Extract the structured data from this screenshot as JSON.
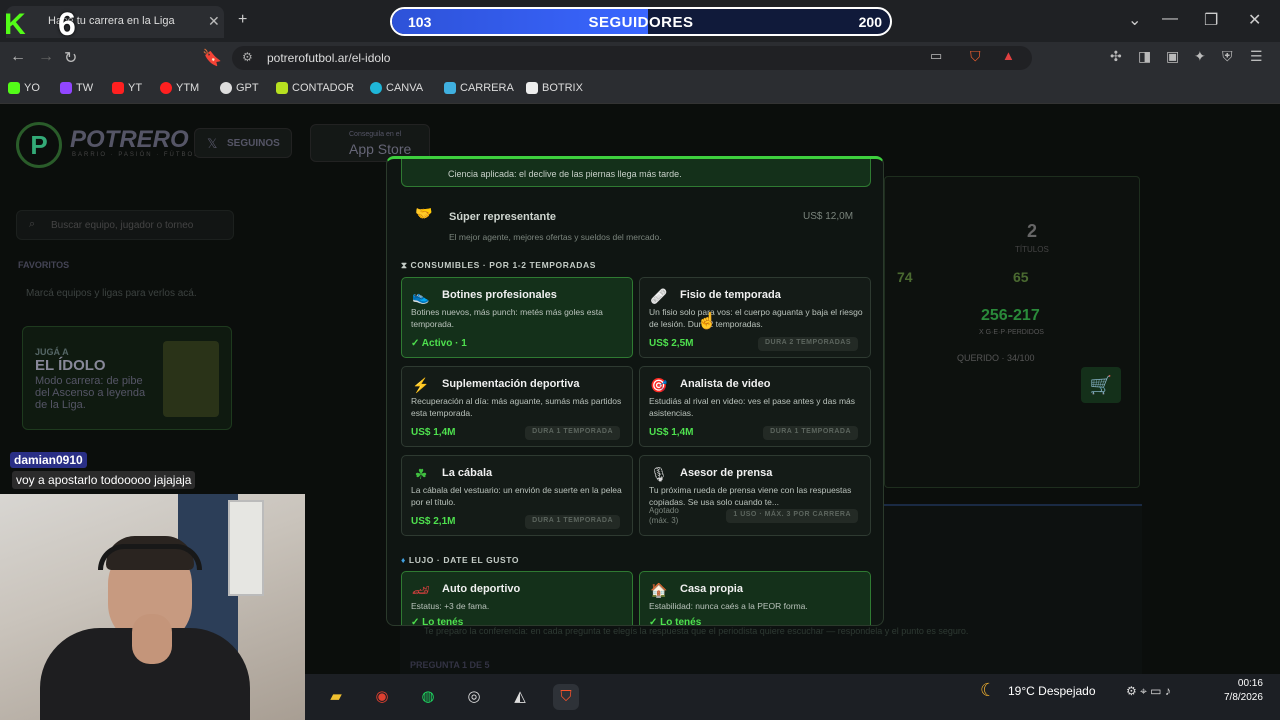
{
  "browser": {
    "tab_title": "Hacé tu carrera en la Liga",
    "url": "potrerofutbol.ar/el-idolo",
    "bookmarks": [
      "YO",
      "TW",
      "YT",
      "YTM",
      "GPT",
      "CONTADOR",
      "CANVA",
      "CARRERA",
      "BOTRIX"
    ]
  },
  "stream": {
    "kick_logo": "K",
    "overlay_number": "6",
    "followers": {
      "current": "103",
      "label": "SEGUIDORES",
      "goal": "200",
      "progress_fraction": 0.515
    },
    "chat": {
      "user": "damian0910",
      "message": "voy a apostarlo todooooo jajajaja"
    }
  },
  "site": {
    "brand": "POTRERO",
    "brand_sub": "BARRIO · PASIÓN · FÚTBOL",
    "follow_button": "SEGUINOS",
    "store_small": "Conseguila en el",
    "store_label": "App Store",
    "search_placeholder": "Buscar equipo, jugador o torneo",
    "favorites_header": "FAVORITOS",
    "favorites_text": "Marcá equipos y ligas para verlos acá.",
    "promo": {
      "kicker": "JUGÁ A",
      "title": "EL ÍDOLO",
      "text": "Modo carrera: de pibe del Ascenso a leyenda de la Liga."
    },
    "stats": {
      "titles_value": "2",
      "titles_label": "TÍTULOS",
      "stat_a": "74",
      "stat_b": "65",
      "record": "256-217",
      "record_label": "X G·E·P·PERDIDOS",
      "querido": "QUERIDO · 34/100"
    },
    "bottom_text": "Te preparo la conferencia: en cada pregunta te elegís la respuesta que el periodista quiere escuchar — respondela y el punto es seguro.",
    "bottom_question": "PREGUNTA 1 DE 5"
  },
  "modal": {
    "top_banner": "Ciencia aplicada: el declive de las piernas llega más tarde.",
    "representante": {
      "title": "Súper representante",
      "desc": "El mejor agente, mejores ofertas y sueldos del mercado.",
      "price": "US$ 12,0M"
    },
    "section_consumibles": "CONSUMIBLES · POR 1-2 TEMPORADAS",
    "cards": [
      {
        "title": "Botines profesionales",
        "desc": "Botines nuevos, más punch: metés más goles esta temporada.",
        "status": "✓ Activo · 1"
      },
      {
        "title": "Fisio de temporada",
        "desc": "Un fisio solo para vos: el cuerpo aguanta y baja el riesgo de lesión. Dura 2 temporadas.",
        "price": "US$ 2,5M",
        "button": "DURA 2 TEMPORADAS"
      },
      {
        "title": "Suplementación deportiva",
        "desc": "Recuperación al día: más aguante, sumás más partidos esta temporada.",
        "price": "US$ 1,4M",
        "button": "DURA 1 TEMPORADA"
      },
      {
        "title": "Analista de video",
        "desc": "Estudiás al rival en video: ves el pase antes y das más asistencias.",
        "price": "US$ 1,4M",
        "button": "DURA 1 TEMPORADA"
      },
      {
        "title": "La cábala",
        "desc": "La cábala del vestuario: un envión de suerte en la pelea por el título.",
        "price": "US$ 2,1M",
        "button": "DURA 1 TEMPORADA"
      },
      {
        "title": "Asesor de prensa",
        "desc": "Tu próxima rueda de prensa viene con las respuestas copiadas. Se usa solo cuando te...",
        "note": "Agotado (máx. 3)",
        "button": "1 USO · MÁX. 3 POR CARRERA"
      }
    ],
    "section_lujo": "LUJO · DATE EL GUSTO",
    "lujo": [
      {
        "title": "Auto deportivo",
        "desc": "Estatus: +3 de fama.",
        "status": "✓ Lo tenés"
      },
      {
        "title": "Casa propia",
        "desc": "Estabilidad: nunca caés a la PEOR forma.",
        "status": "✓ Lo tenés"
      }
    ]
  },
  "taskbar": {
    "weather": "19°C  Despejado",
    "time": "00:16",
    "date": "7/8/2026"
  },
  "colors": {
    "accent": "#3ed03e",
    "kick": "#53fc18",
    "follower_bar": "#3a66ff"
  }
}
